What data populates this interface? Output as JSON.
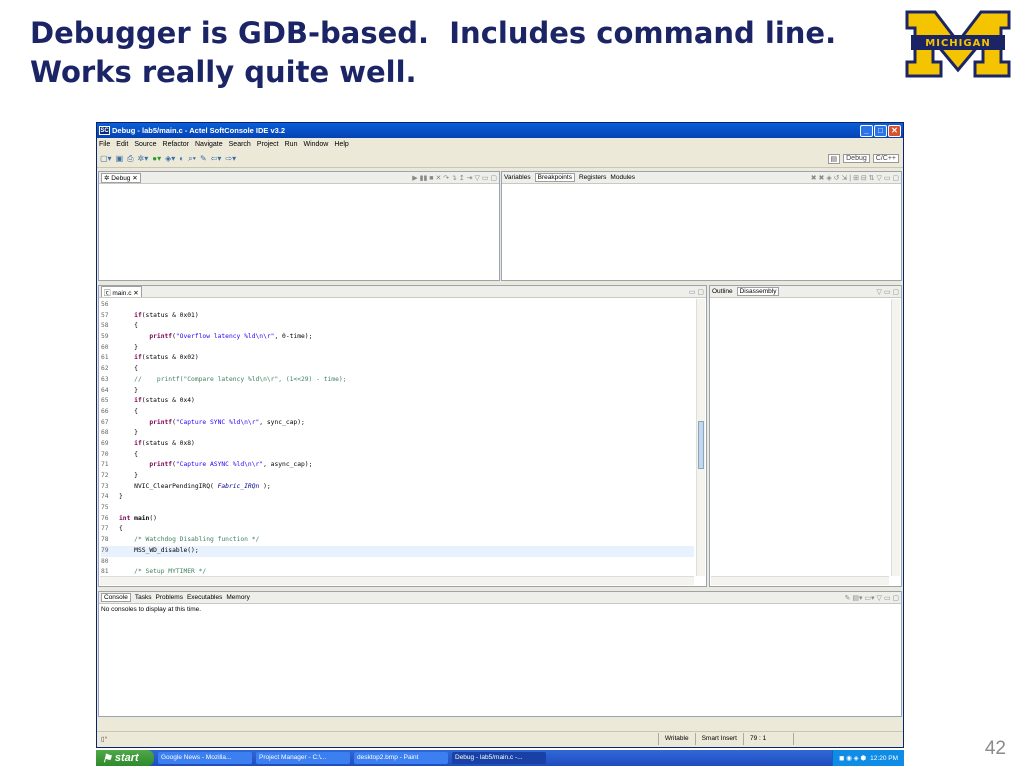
{
  "slide": {
    "title_line1": "Debugger is GDB-based.  Includes command line.",
    "title_line2": "Works really quite well.",
    "page_number": "42",
    "logo_text": "MICHIGAN"
  },
  "window": {
    "title": "Debug - lab5/main.c - Actel SoftConsole IDE v3.2",
    "app_icon": "SC",
    "controls": [
      "_",
      "□",
      "✕"
    ]
  },
  "menu": [
    "File",
    "Edit",
    "Source",
    "Refactor",
    "Navigate",
    "Search",
    "Project",
    "Run",
    "Window",
    "Help"
  ],
  "perspectives": {
    "debug": "Debug",
    "cpp": "C/C++"
  },
  "debug_view": {
    "tab": "Debug"
  },
  "vars_view": {
    "tabs": [
      "Variables",
      "Breakpoints",
      "Registers",
      "Modules"
    ],
    "active": "Breakpoints"
  },
  "editor": {
    "tab": "main.c",
    "lines": [
      {
        "n": "56",
        "html": ""
      },
      {
        "n": "57",
        "html": "    <span class='kw'>if</span>(status &amp; 0x01)"
      },
      {
        "n": "58",
        "html": "    {"
      },
      {
        "n": "59",
        "html": "        <span class='kw'>printf</span>(<span class='str'>\"Overflow latency %ld\\n\\r\"</span>, 0-time);"
      },
      {
        "n": "60",
        "html": "    }"
      },
      {
        "n": "61",
        "html": "    <span class='kw'>if</span>(status &amp; 0x02)"
      },
      {
        "n": "62",
        "html": "    {"
      },
      {
        "n": "63",
        "html": "    <span class='cm'>//    printf(\"Compare latency %ld\\n\\r\", (1&lt;&lt;29) - time);</span>"
      },
      {
        "n": "64",
        "html": "    }"
      },
      {
        "n": "65",
        "html": "    <span class='kw'>if</span>(status &amp; 0x4)"
      },
      {
        "n": "66",
        "html": "    {"
      },
      {
        "n": "67",
        "html": "        <span class='kw'>printf</span>(<span class='str'>\"Capture SYNC %ld\\n\\r\"</span>, sync_cap);"
      },
      {
        "n": "68",
        "html": "    }"
      },
      {
        "n": "69",
        "html": "    <span class='kw'>if</span>(status &amp; 0x8)"
      },
      {
        "n": "70",
        "html": "    {"
      },
      {
        "n": "71",
        "html": "        <span class='kw'>printf</span>(<span class='str'>\"Capture ASYNC %ld\\n\\r\"</span>, async_cap);"
      },
      {
        "n": "72",
        "html": "    }"
      },
      {
        "n": "73",
        "html": "    NVIC_ClearPendingIRQ( <span class='it'>Fabric_IRQn</span> );"
      },
      {
        "n": "74",
        "html": "}"
      },
      {
        "n": "75",
        "html": ""
      },
      {
        "n": "76",
        "html": "<span class='kw'>int</span> <b>main</b>()"
      },
      {
        "n": "77",
        "html": "{"
      },
      {
        "n": "78",
        "html": "    <span class='cm'>/* Watchdog Disabling function */</span>"
      },
      {
        "n": "79",
        "html": "    MSS_WD_disable();",
        "highlight": true
      },
      {
        "n": "80",
        "html": ""
      },
      {
        "n": "81",
        "html": "    <span class='cm'>/* Setup MYTIMER */</span>"
      }
    ]
  },
  "outline_view": {
    "tabs": [
      "Outline",
      "Disassembly"
    ]
  },
  "console": {
    "tabs": [
      "Console",
      "Tasks",
      "Problems",
      "Executables",
      "Memory"
    ],
    "message": "No consoles to display at this time."
  },
  "status": {
    "writable": "Writable",
    "insert": "Smart Insert",
    "position": "79 : 1"
  },
  "taskbar": {
    "start": "start",
    "items": [
      "Google News - Mozilla...",
      "Project Manager - C:\\...",
      "desktop2.bmp - Paint",
      "Debug - lab5/main.c -..."
    ],
    "clock": "12:20 PM"
  }
}
